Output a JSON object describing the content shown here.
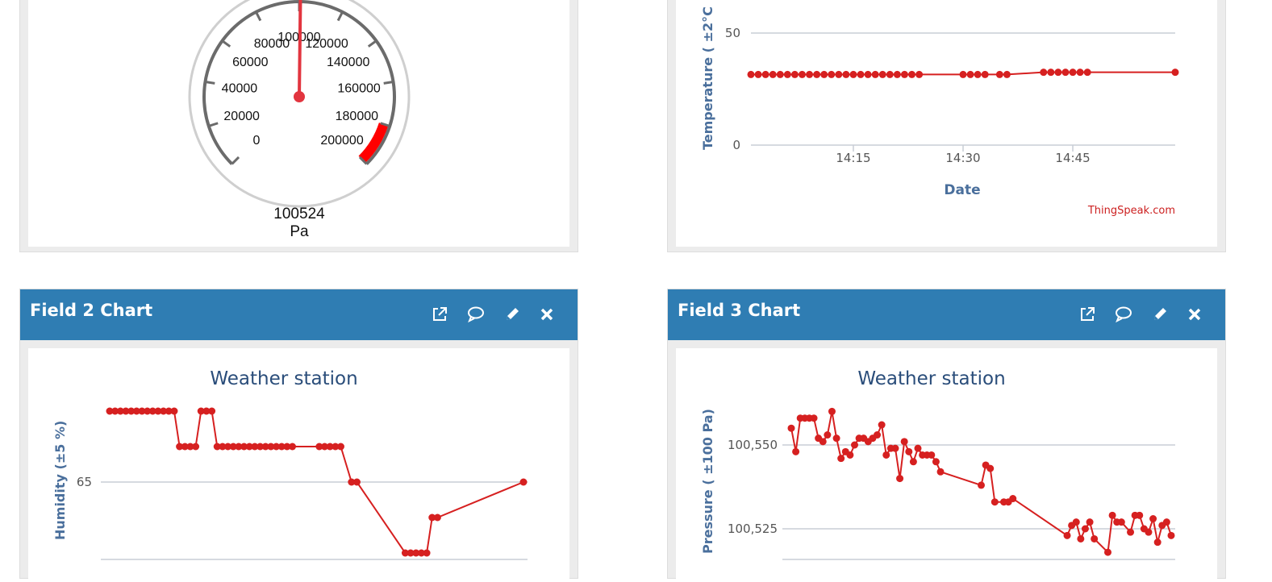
{
  "top_left": {
    "gauge": {
      "value_text": "100524",
      "unit": "Pa",
      "value": 100524,
      "min": 0,
      "max": 200000,
      "ticks": [
        "0",
        "20000",
        "40000",
        "60000",
        "80000",
        "100000",
        "120000",
        "140000",
        "160000",
        "180000",
        "200000"
      ],
      "alarm_band_start": 180000,
      "alarm_color": "#ff0000",
      "needle_color": "#e2353f"
    }
  },
  "top_right": {
    "chart_data": {
      "type": "line",
      "ylabel": "Temperature ( ±2°C",
      "xlabel": "Date",
      "credit": "ThingSpeak.com",
      "yticks": [
        "50",
        "0"
      ],
      "xticks": [
        "14:15",
        "14:30",
        "14:45"
      ],
      "ylim_visible": [
        0,
        50
      ],
      "series_color": "#d62020",
      "points": [
        [
          "14:01",
          31.5
        ],
        [
          "14:02",
          31.5
        ],
        [
          "14:03",
          31.5
        ],
        [
          "14:04",
          31.5
        ],
        [
          "14:05",
          31.5
        ],
        [
          "14:06",
          31.5
        ],
        [
          "14:07",
          31.5
        ],
        [
          "14:08",
          31.5
        ],
        [
          "14:09",
          31.5
        ],
        [
          "14:10",
          31.5
        ],
        [
          "14:11",
          31.5
        ],
        [
          "14:12",
          31.5
        ],
        [
          "14:13",
          31.5
        ],
        [
          "14:14",
          31.5
        ],
        [
          "14:15",
          31.5
        ],
        [
          "14:16",
          31.5
        ],
        [
          "14:17",
          31.5
        ],
        [
          "14:18",
          31.5
        ],
        [
          "14:19",
          31.5
        ],
        [
          "14:20",
          31.5
        ],
        [
          "14:21",
          31.5
        ],
        [
          "14:22",
          31.5
        ],
        [
          "14:23",
          31.5
        ],
        [
          "14:24",
          31.5
        ],
        [
          "14:30",
          31.5
        ],
        [
          "14:31",
          31.5
        ],
        [
          "14:32",
          31.5
        ],
        [
          "14:33",
          31.5
        ],
        [
          "14:35",
          31.5
        ],
        [
          "14:36",
          31.5
        ],
        [
          "14:41",
          32.5
        ],
        [
          "14:42",
          32.5
        ],
        [
          "14:43",
          32.5
        ],
        [
          "14:44",
          32.5
        ],
        [
          "14:45",
          32.5
        ],
        [
          "14:46",
          32.5
        ],
        [
          "14:47",
          32.5
        ],
        [
          "14:59",
          32.5
        ]
      ]
    }
  },
  "field2": {
    "title": "Field 2 Chart",
    "chart_data": {
      "type": "line",
      "title": "Weather station",
      "ylabel": "Humidity (±5 %)",
      "yticks": [
        "65"
      ],
      "series_color": "#d62020",
      "points": [
        [
          1,
          70
        ],
        [
          2,
          70
        ],
        [
          3,
          70
        ],
        [
          4,
          70
        ],
        [
          5,
          70
        ],
        [
          6,
          70
        ],
        [
          7,
          70
        ],
        [
          8,
          70
        ],
        [
          9,
          70
        ],
        [
          10,
          70
        ],
        [
          11,
          70
        ],
        [
          12,
          70
        ],
        [
          13,
          70
        ],
        [
          14,
          67.5
        ],
        [
          15,
          67.5
        ],
        [
          16,
          67.5
        ],
        [
          17,
          67.5
        ],
        [
          18,
          70
        ],
        [
          19,
          70
        ],
        [
          20,
          70
        ],
        [
          21,
          67.5
        ],
        [
          22,
          67.5
        ],
        [
          23,
          67.5
        ],
        [
          24,
          67.5
        ],
        [
          25,
          67.5
        ],
        [
          26,
          67.5
        ],
        [
          27,
          67.5
        ],
        [
          28,
          67.5
        ],
        [
          29,
          67.5
        ],
        [
          30,
          67.5
        ],
        [
          31,
          67.5
        ],
        [
          32,
          67.5
        ],
        [
          33,
          67.5
        ],
        [
          34,
          67.5
        ],
        [
          35,
          67.5
        ],
        [
          40,
          67.5
        ],
        [
          41,
          67.5
        ],
        [
          42,
          67.5
        ],
        [
          43,
          67.5
        ],
        [
          44,
          67.5
        ],
        [
          46,
          65
        ],
        [
          47,
          65
        ],
        [
          56,
          60
        ],
        [
          57,
          60
        ],
        [
          58,
          60
        ],
        [
          59,
          60
        ],
        [
          60,
          60
        ],
        [
          61,
          62.5
        ],
        [
          62,
          62.5
        ],
        [
          78,
          65
        ]
      ]
    }
  },
  "field3": {
    "title": "Field 3 Chart",
    "chart_data": {
      "type": "line",
      "title": "Weather station",
      "ylabel": "Pressure ( ±100 Pa)",
      "yticks": [
        "100,550",
        "100,525"
      ],
      "series_color": "#d62020",
      "points": [
        [
          1,
          100555
        ],
        [
          2,
          100548
        ],
        [
          3,
          100558
        ],
        [
          4,
          100558
        ],
        [
          5,
          100558
        ],
        [
          6,
          100558
        ],
        [
          7,
          100552
        ],
        [
          8,
          100551
        ],
        [
          9,
          100553
        ],
        [
          10,
          100560
        ],
        [
          11,
          100552
        ],
        [
          12,
          100546
        ],
        [
          13,
          100548
        ],
        [
          14,
          100547
        ],
        [
          15,
          100550
        ],
        [
          16,
          100552
        ],
        [
          17,
          100552
        ],
        [
          18,
          100551
        ],
        [
          19,
          100552
        ],
        [
          20,
          100553
        ],
        [
          21,
          100556
        ],
        [
          22,
          100547
        ],
        [
          23,
          100549
        ],
        [
          24,
          100549
        ],
        [
          25,
          100540
        ],
        [
          26,
          100551
        ],
        [
          27,
          100548
        ],
        [
          28,
          100545
        ],
        [
          29,
          100549
        ],
        [
          30,
          100547
        ],
        [
          31,
          100547
        ],
        [
          32,
          100547
        ],
        [
          33,
          100545
        ],
        [
          34,
          100542
        ],
        [
          43,
          100538
        ],
        [
          44,
          100544
        ],
        [
          45,
          100543
        ],
        [
          46,
          100533
        ],
        [
          48,
          100533
        ],
        [
          49,
          100533
        ],
        [
          50,
          100534
        ],
        [
          62,
          100523
        ],
        [
          63,
          100526
        ],
        [
          64,
          100527
        ],
        [
          65,
          100522
        ],
        [
          66,
          100525
        ],
        [
          67,
          100527
        ],
        [
          68,
          100522
        ],
        [
          71,
          100518
        ],
        [
          72,
          100529
        ],
        [
          73,
          100527
        ],
        [
          74,
          100527
        ],
        [
          76,
          100524
        ],
        [
          77,
          100529
        ],
        [
          78,
          100529
        ],
        [
          79,
          100525
        ],
        [
          80,
          100524
        ],
        [
          81,
          100528
        ],
        [
          82,
          100521
        ],
        [
          83,
          100526
        ],
        [
          84,
          100527
        ],
        [
          85,
          100523
        ]
      ]
    }
  }
}
